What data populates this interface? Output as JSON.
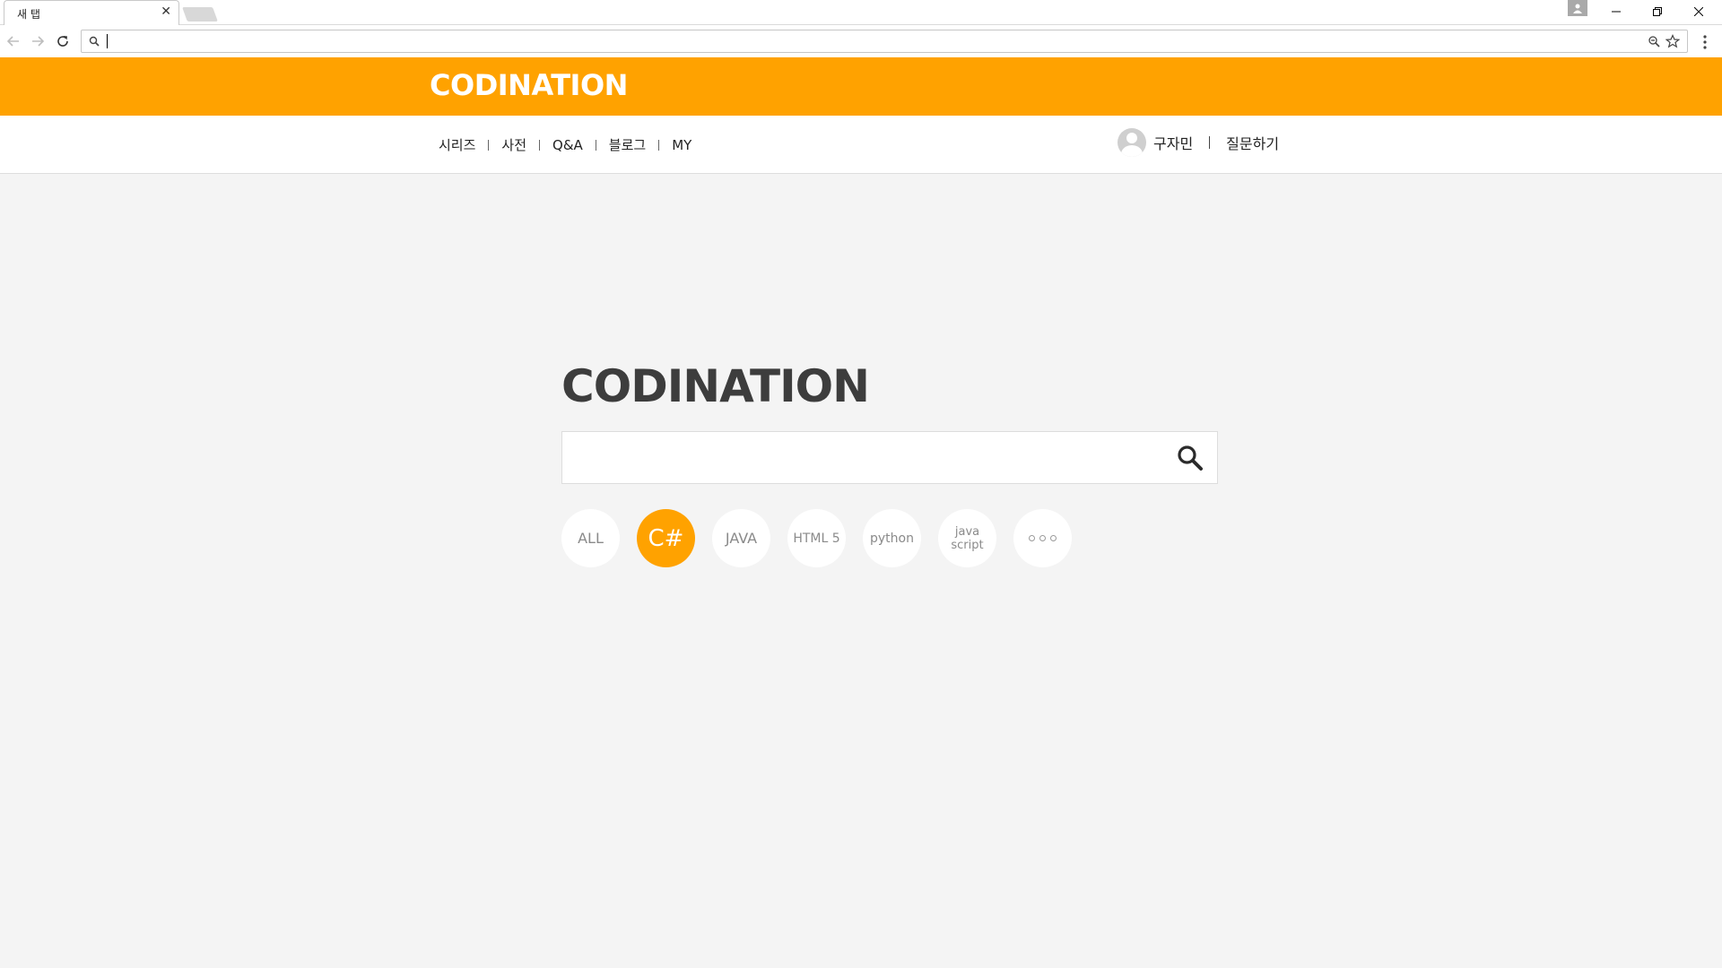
{
  "browser": {
    "tab_title": "새 탭",
    "tab_close": "✕",
    "address_value": ""
  },
  "site": {
    "brand": "CODINATION",
    "accent_color": "#ffa200",
    "nav": [
      "시리즈",
      "사전",
      "Q&A",
      "블로그",
      "MY"
    ],
    "user_name": "구자민",
    "ask_link": "질문하기"
  },
  "main": {
    "title": "CODINATION",
    "search_value": "",
    "categories": [
      {
        "label": "ALL",
        "selected": false
      },
      {
        "label": "C#",
        "selected": true
      },
      {
        "label": "JAVA",
        "selected": false
      },
      {
        "label": "HTML 5",
        "selected": false
      },
      {
        "label": "python",
        "selected": false
      },
      {
        "label": "java",
        "label2": "script",
        "selected": false
      },
      {
        "label": "more",
        "icon": "more-dots-icon",
        "selected": false
      }
    ]
  }
}
